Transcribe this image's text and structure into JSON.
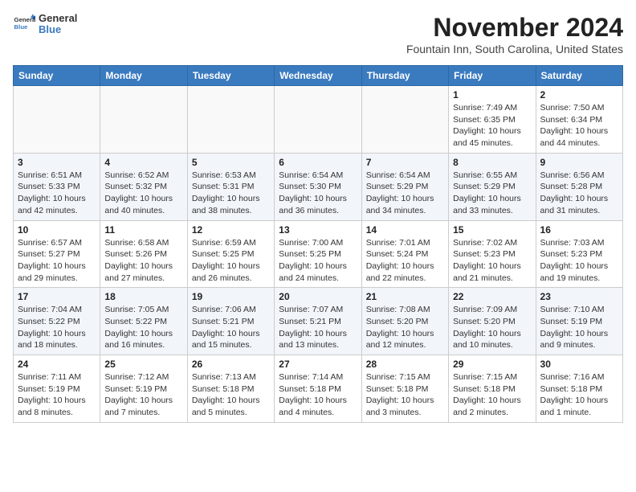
{
  "header": {
    "logo": {
      "general": "General",
      "blue": "Blue"
    },
    "title": "November 2024",
    "subtitle": "Fountain Inn, South Carolina, United States"
  },
  "days_of_week": [
    "Sunday",
    "Monday",
    "Tuesday",
    "Wednesday",
    "Thursday",
    "Friday",
    "Saturday"
  ],
  "weeks": [
    [
      {
        "day": "",
        "info": ""
      },
      {
        "day": "",
        "info": ""
      },
      {
        "day": "",
        "info": ""
      },
      {
        "day": "",
        "info": ""
      },
      {
        "day": "",
        "info": ""
      },
      {
        "day": "1",
        "info": "Sunrise: 7:49 AM\nSunset: 6:35 PM\nDaylight: 10 hours and 45 minutes."
      },
      {
        "day": "2",
        "info": "Sunrise: 7:50 AM\nSunset: 6:34 PM\nDaylight: 10 hours and 44 minutes."
      }
    ],
    [
      {
        "day": "3",
        "info": "Sunrise: 6:51 AM\nSunset: 5:33 PM\nDaylight: 10 hours and 42 minutes."
      },
      {
        "day": "4",
        "info": "Sunrise: 6:52 AM\nSunset: 5:32 PM\nDaylight: 10 hours and 40 minutes."
      },
      {
        "day": "5",
        "info": "Sunrise: 6:53 AM\nSunset: 5:31 PM\nDaylight: 10 hours and 38 minutes."
      },
      {
        "day": "6",
        "info": "Sunrise: 6:54 AM\nSunset: 5:30 PM\nDaylight: 10 hours and 36 minutes."
      },
      {
        "day": "7",
        "info": "Sunrise: 6:54 AM\nSunset: 5:29 PM\nDaylight: 10 hours and 34 minutes."
      },
      {
        "day": "8",
        "info": "Sunrise: 6:55 AM\nSunset: 5:29 PM\nDaylight: 10 hours and 33 minutes."
      },
      {
        "day": "9",
        "info": "Sunrise: 6:56 AM\nSunset: 5:28 PM\nDaylight: 10 hours and 31 minutes."
      }
    ],
    [
      {
        "day": "10",
        "info": "Sunrise: 6:57 AM\nSunset: 5:27 PM\nDaylight: 10 hours and 29 minutes."
      },
      {
        "day": "11",
        "info": "Sunrise: 6:58 AM\nSunset: 5:26 PM\nDaylight: 10 hours and 27 minutes."
      },
      {
        "day": "12",
        "info": "Sunrise: 6:59 AM\nSunset: 5:25 PM\nDaylight: 10 hours and 26 minutes."
      },
      {
        "day": "13",
        "info": "Sunrise: 7:00 AM\nSunset: 5:25 PM\nDaylight: 10 hours and 24 minutes."
      },
      {
        "day": "14",
        "info": "Sunrise: 7:01 AM\nSunset: 5:24 PM\nDaylight: 10 hours and 22 minutes."
      },
      {
        "day": "15",
        "info": "Sunrise: 7:02 AM\nSunset: 5:23 PM\nDaylight: 10 hours and 21 minutes."
      },
      {
        "day": "16",
        "info": "Sunrise: 7:03 AM\nSunset: 5:23 PM\nDaylight: 10 hours and 19 minutes."
      }
    ],
    [
      {
        "day": "17",
        "info": "Sunrise: 7:04 AM\nSunset: 5:22 PM\nDaylight: 10 hours and 18 minutes."
      },
      {
        "day": "18",
        "info": "Sunrise: 7:05 AM\nSunset: 5:22 PM\nDaylight: 10 hours and 16 minutes."
      },
      {
        "day": "19",
        "info": "Sunrise: 7:06 AM\nSunset: 5:21 PM\nDaylight: 10 hours and 15 minutes."
      },
      {
        "day": "20",
        "info": "Sunrise: 7:07 AM\nSunset: 5:21 PM\nDaylight: 10 hours and 13 minutes."
      },
      {
        "day": "21",
        "info": "Sunrise: 7:08 AM\nSunset: 5:20 PM\nDaylight: 10 hours and 12 minutes."
      },
      {
        "day": "22",
        "info": "Sunrise: 7:09 AM\nSunset: 5:20 PM\nDaylight: 10 hours and 10 minutes."
      },
      {
        "day": "23",
        "info": "Sunrise: 7:10 AM\nSunset: 5:19 PM\nDaylight: 10 hours and 9 minutes."
      }
    ],
    [
      {
        "day": "24",
        "info": "Sunrise: 7:11 AM\nSunset: 5:19 PM\nDaylight: 10 hours and 8 minutes."
      },
      {
        "day": "25",
        "info": "Sunrise: 7:12 AM\nSunset: 5:19 PM\nDaylight: 10 hours and 7 minutes."
      },
      {
        "day": "26",
        "info": "Sunrise: 7:13 AM\nSunset: 5:18 PM\nDaylight: 10 hours and 5 minutes."
      },
      {
        "day": "27",
        "info": "Sunrise: 7:14 AM\nSunset: 5:18 PM\nDaylight: 10 hours and 4 minutes."
      },
      {
        "day": "28",
        "info": "Sunrise: 7:15 AM\nSunset: 5:18 PM\nDaylight: 10 hours and 3 minutes."
      },
      {
        "day": "29",
        "info": "Sunrise: 7:15 AM\nSunset: 5:18 PM\nDaylight: 10 hours and 2 minutes."
      },
      {
        "day": "30",
        "info": "Sunrise: 7:16 AM\nSunset: 5:18 PM\nDaylight: 10 hours and 1 minute."
      }
    ]
  ]
}
